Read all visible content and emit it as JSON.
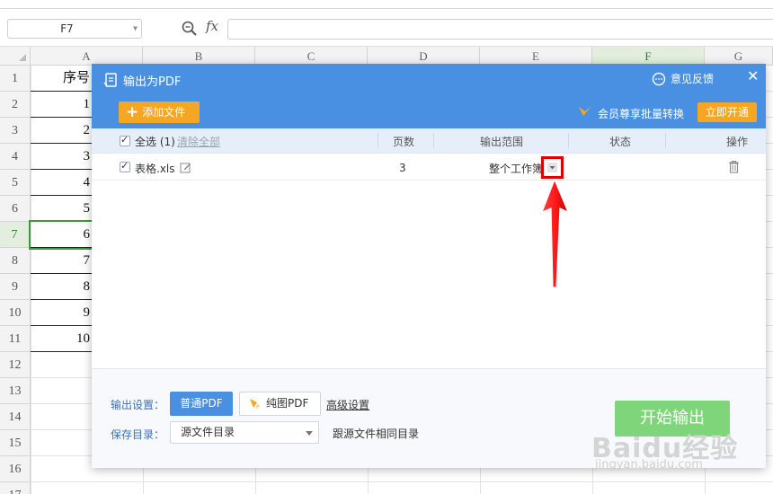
{
  "spreadsheet": {
    "name_box": "F7",
    "fx_label": "fx",
    "columns": [
      "A",
      "B",
      "C",
      "D",
      "E",
      "F",
      "G"
    ],
    "selected_column": "F",
    "rows": [
      "1",
      "2",
      "3",
      "4",
      "5",
      "6",
      "7",
      "8",
      "9",
      "10",
      "11",
      "12",
      "13",
      "14",
      "15",
      "16",
      "17"
    ],
    "selected_row": "7",
    "column_a_values": [
      "序号",
      "1",
      "2",
      "3",
      "4",
      "5",
      "6",
      "7",
      "8",
      "9",
      "10"
    ]
  },
  "dialog": {
    "title": "输出为PDF",
    "feedback": "意见反馈",
    "close": "✕",
    "add_file": "添加文件",
    "vip_promo": "会员尊享批量转换",
    "vip_button": "立即开通",
    "table": {
      "select_all": "全选 (1)",
      "clear_all": "清除全部",
      "headers": [
        "页数",
        "输出范围",
        "状态",
        "操作"
      ],
      "rows": [
        {
          "filename": "表格.xls",
          "pages": "3",
          "range": "整个工作簿"
        }
      ]
    },
    "footer": {
      "output_settings_label": "输出设置：",
      "normal_pdf": "普通PDF",
      "image_pdf": "纯图PDF",
      "advanced": "高级设置",
      "save_dir_label": "保存目录：",
      "save_dir_value": "源文件目录",
      "same_dir_note": "跟源文件相同目录",
      "start": "开始输出"
    }
  },
  "watermark": {
    "main": "Baidu经验",
    "sub": "jingyan.baidu.com"
  },
  "colors": {
    "header_blue": "#4a90e2",
    "orange": "#f5a623",
    "start_green": "#7fd67a",
    "highlight_red": "#e10000",
    "selection_green": "#3b9a3f"
  }
}
